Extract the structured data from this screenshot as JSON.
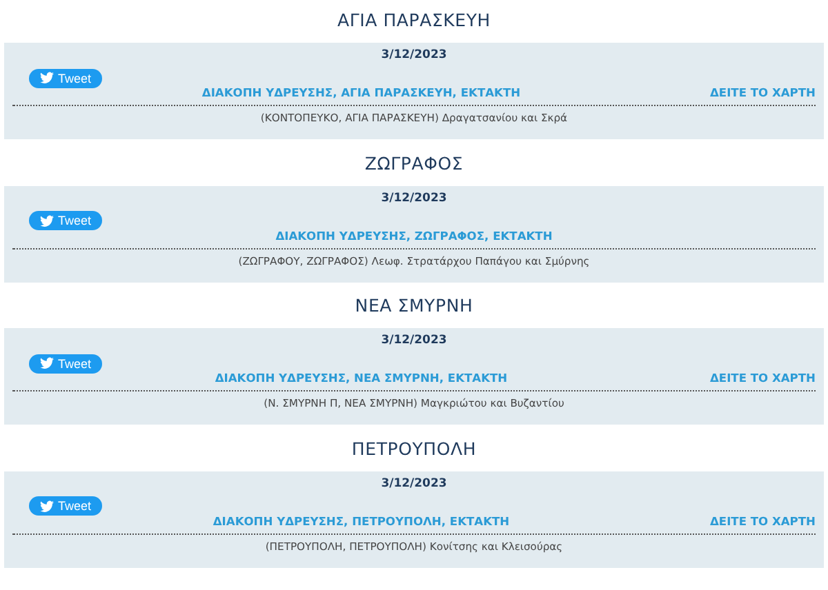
{
  "sections": [
    {
      "area": "ΑΓΙΑ ΠΑΡΑΣΚΕΥΗ",
      "date": "3/12/2023",
      "tweet": "Tweet",
      "title": "ΔΙΑΚΟΠΗ ΥΔΡΕΥΣΗΣ, ΑΓΙΑ ΠΑΡΑΣΚΕΥΗ, ΕΚΤΑΚΤΗ",
      "map_link": "ΔΕΙΤΕ ΤΟ ΧΑΡΤΗ",
      "details": "(ΚΟΝΤΟΠΕΥΚΟ, ΑΓΙΑ ΠΑΡΑΣΚΕΥΗ) Δραγατσανίου και Σκρά"
    },
    {
      "area": "ΖΩΓΡΑΦΟΣ",
      "date": "3/12/2023",
      "tweet": "Tweet",
      "title": "ΔΙΑΚΟΠΗ ΥΔΡΕΥΣΗΣ, ΖΩΓΡΑΦΟΣ, ΕΚΤΑΚΤΗ",
      "details": "(ΖΩΓΡΑΦΟΥ, ΖΩΓΡΑΦΟΣ) Λεωφ. Στρατάρχου Παπάγου και Σμύρνης"
    },
    {
      "area": "ΝΕΑ ΣΜΥΡΝΗ",
      "date": "3/12/2023",
      "tweet": "Tweet",
      "title": "ΔΙΑΚΟΠΗ ΥΔΡΕΥΣΗΣ, ΝΕΑ ΣΜΥΡΝΗ, ΕΚΤΑΚΤΗ",
      "map_link": "ΔΕΙΤΕ ΤΟ ΧΑΡΤΗ",
      "details": "(Ν. ΣΜΥΡΝΗ Π, ΝΕΑ ΣΜΥΡΝΗ) Μαγκριώτου και Βυζαντίου"
    },
    {
      "area": "ΠΕΤΡΟΥΠΟΛΗ",
      "date": "3/12/2023",
      "tweet": "Tweet",
      "title": "ΔΙΑΚΟΠΗ ΥΔΡΕΥΣΗΣ, ΠΕΤΡΟΥΠΟΛΗ, ΕΚΤΑΚΤΗ",
      "map_link": "ΔΕΙΤΕ ΤΟ ΧΑΡΤΗ",
      "details": "(ΠΕΤΡΟΥΠΟΛΗ, ΠΕΤΡΟΥΠΟΛΗ) Κονίτσης και Κλεισούρας"
    }
  ]
}
